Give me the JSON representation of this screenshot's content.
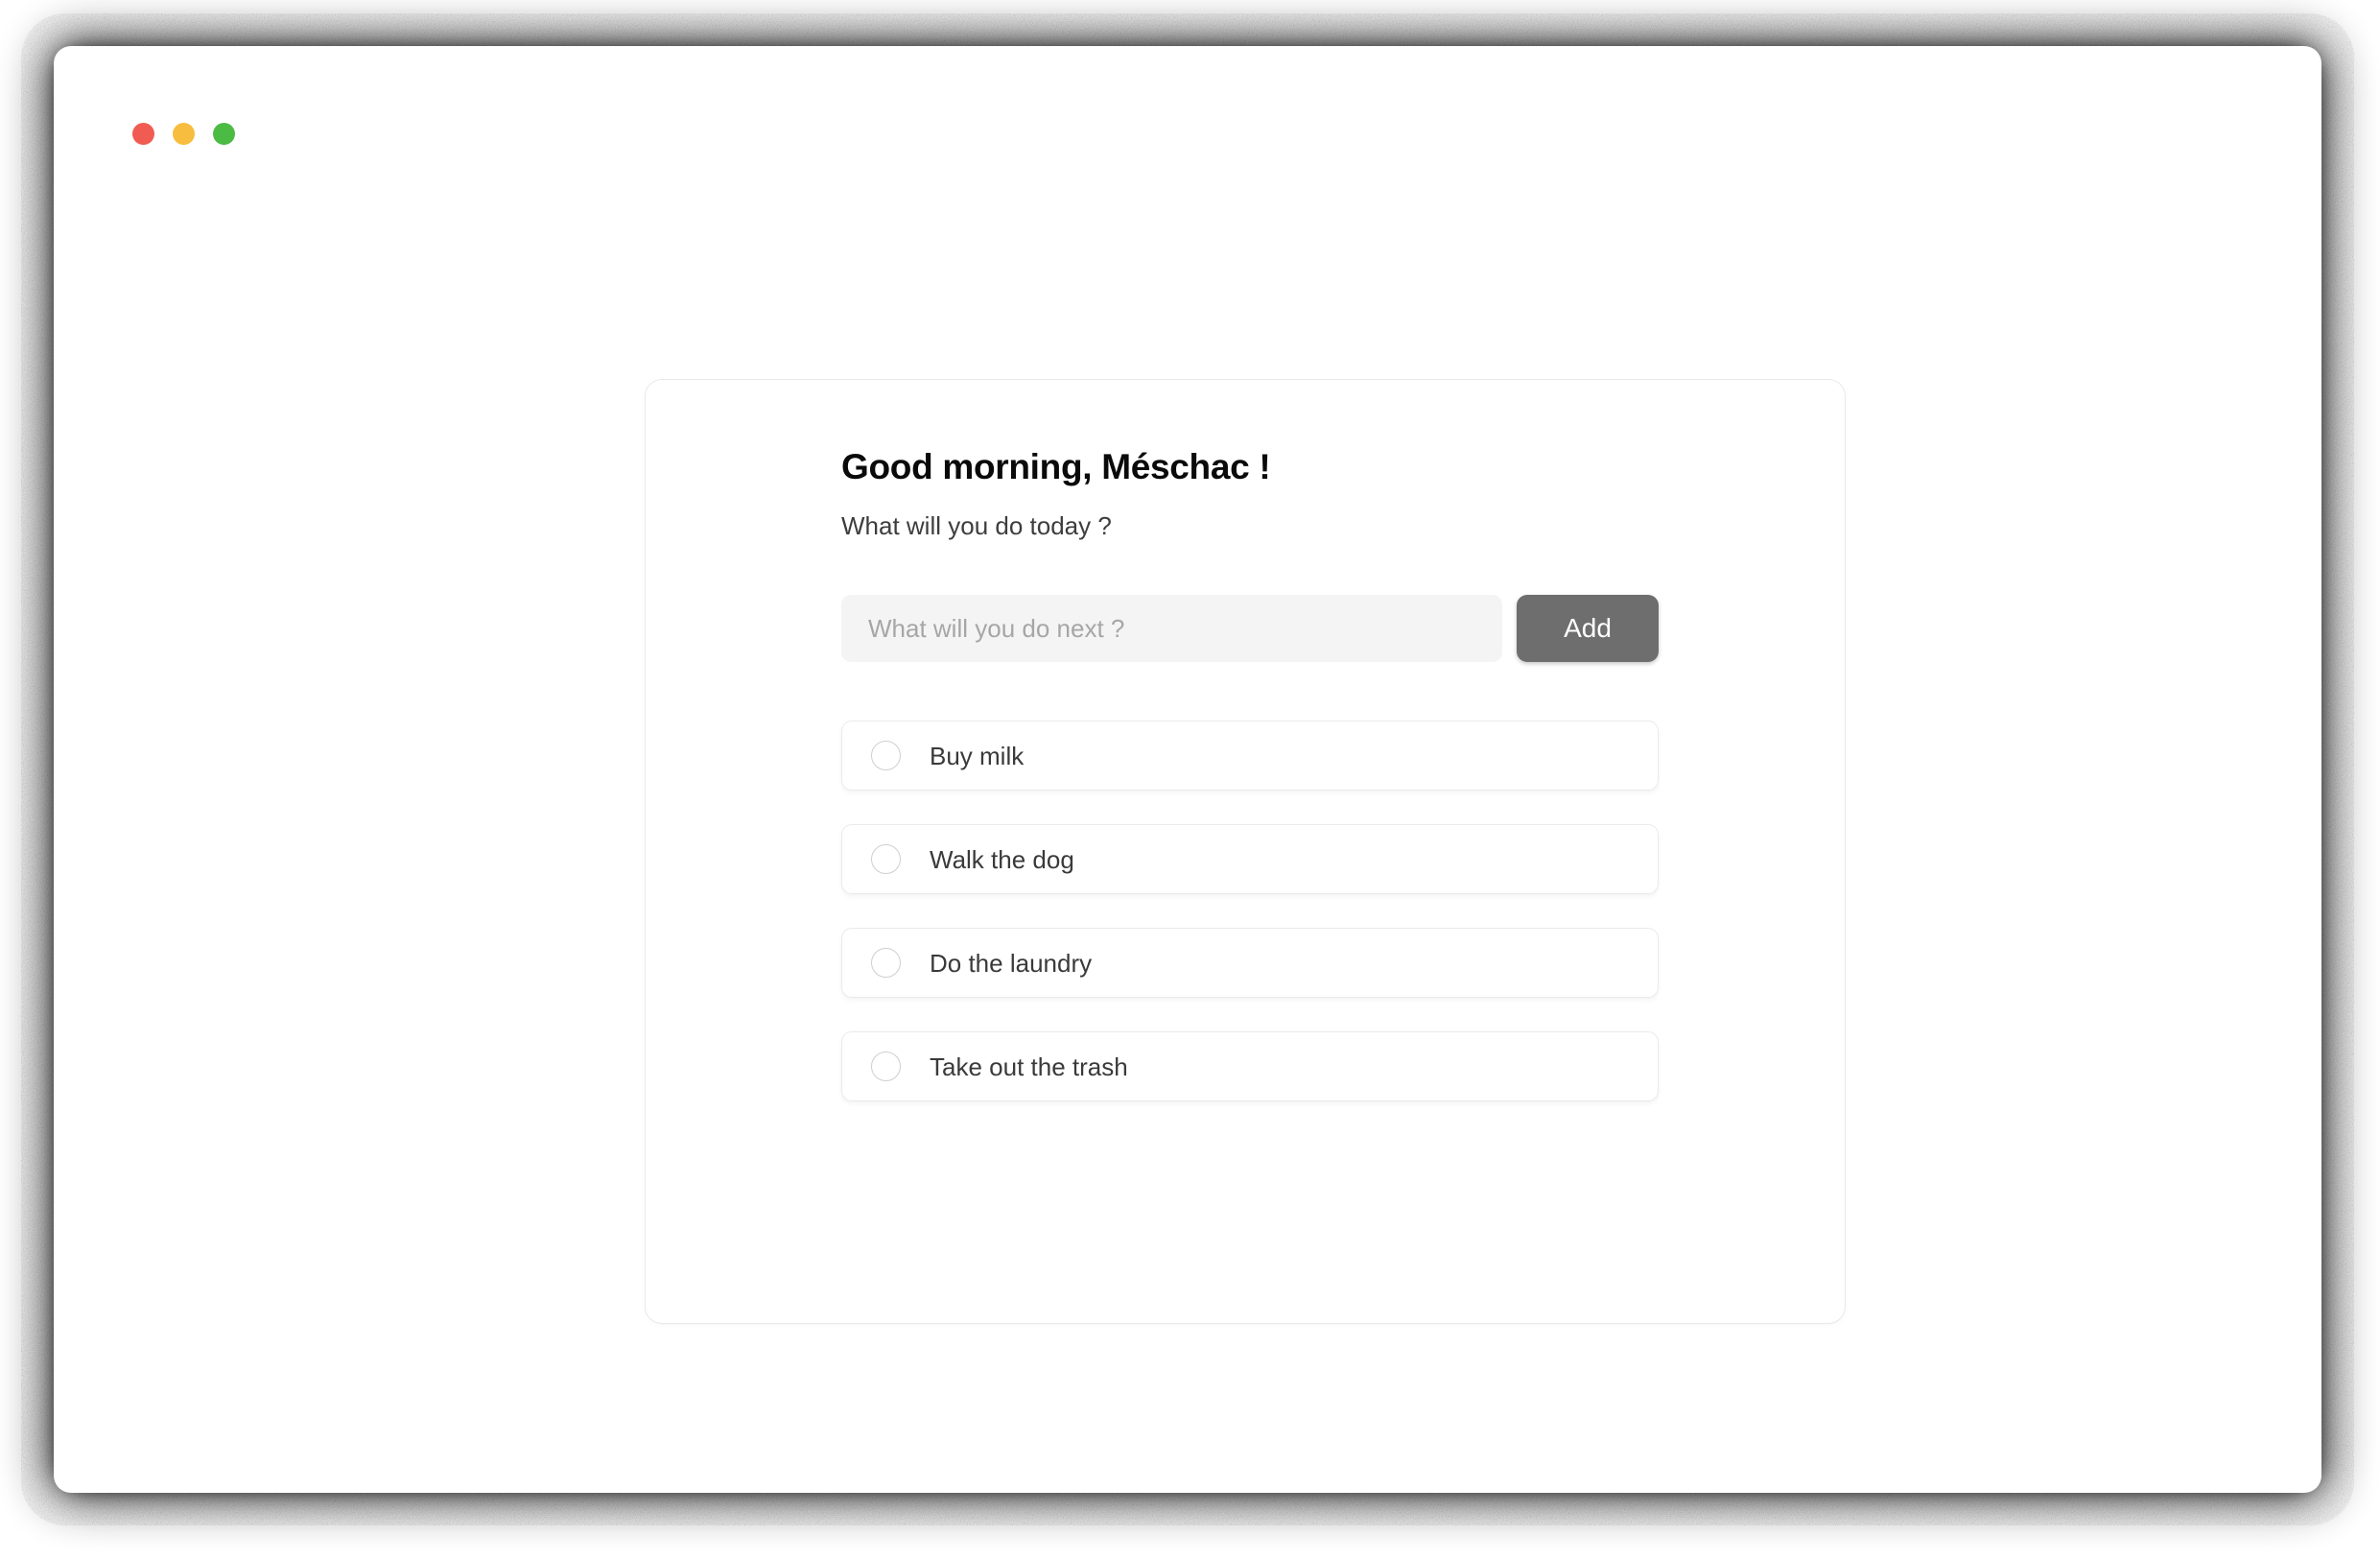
{
  "window": {
    "controls": [
      {
        "name": "close",
        "color": "#f05b52"
      },
      {
        "name": "minimize",
        "color": "#f7bd3e"
      },
      {
        "name": "maximize",
        "color": "#4cbb44"
      }
    ]
  },
  "card": {
    "greeting": "Good morning, Méschac !",
    "subtitle": "What will you do today ?",
    "add_form": {
      "input_value": "",
      "input_placeholder": "What will you do next ?",
      "submit_label": "Add"
    },
    "tasks": [
      {
        "label": "Buy milk",
        "done": false
      },
      {
        "label": "Walk the dog",
        "done": false
      },
      {
        "label": "Do the laundry",
        "done": false
      },
      {
        "label": "Take out the trash",
        "done": false
      }
    ]
  },
  "colors": {
    "button_bg": "#6e6e6e",
    "input_bg": "#f4f4f4",
    "card_border": "#e9e9e9",
    "text_primary": "#0a0a0a",
    "text_secondary": "#3d3d3d",
    "placeholder": "#a6a6a6"
  }
}
